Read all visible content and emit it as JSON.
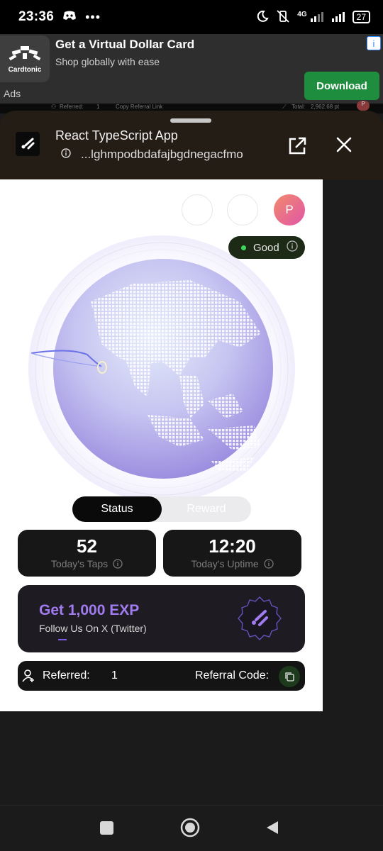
{
  "status_bar": {
    "time": "23:36",
    "network": "4G",
    "battery": "27"
  },
  "ad": {
    "brand": "Cardtonic",
    "title": "Get a Virtual Dollar Card",
    "subtitle": "Shop globally with ease",
    "cta": "Download",
    "ads_label": "Ads"
  },
  "background_page": {
    "referred_label": "Referred:",
    "referred_value": "1",
    "copy_link": "Copy Referral Link",
    "total_label": "Total:",
    "total_value": "2,962.68 pt",
    "avatar_initial": "P"
  },
  "sheet": {
    "title": "React TypeScript App",
    "url": "...lghmpodbdafajbgdnegacfmo"
  },
  "app": {
    "avatar_initial": "P",
    "status_badge": "Good",
    "tabs": [
      {
        "label": "Status",
        "active": true
      },
      {
        "label": "Reward",
        "active": false
      }
    ],
    "stats": [
      {
        "value": "52",
        "label": "Today's Taps"
      },
      {
        "value": "12:20",
        "label": "Today's Uptime"
      }
    ],
    "exp_card": {
      "title": "Get 1,000 EXP",
      "subtitle": "Follow Us On X (Twitter)"
    },
    "referral": {
      "referred_label": "Referred:",
      "referred_value": "1",
      "code_label": "Referral Code:"
    }
  },
  "colors": {
    "accent": "#a07cf0",
    "good_dot": "#3cd65b",
    "ad_button": "#1e8e3e",
    "avatar_from": "#f28a6b",
    "avatar_to": "#e056a8"
  }
}
